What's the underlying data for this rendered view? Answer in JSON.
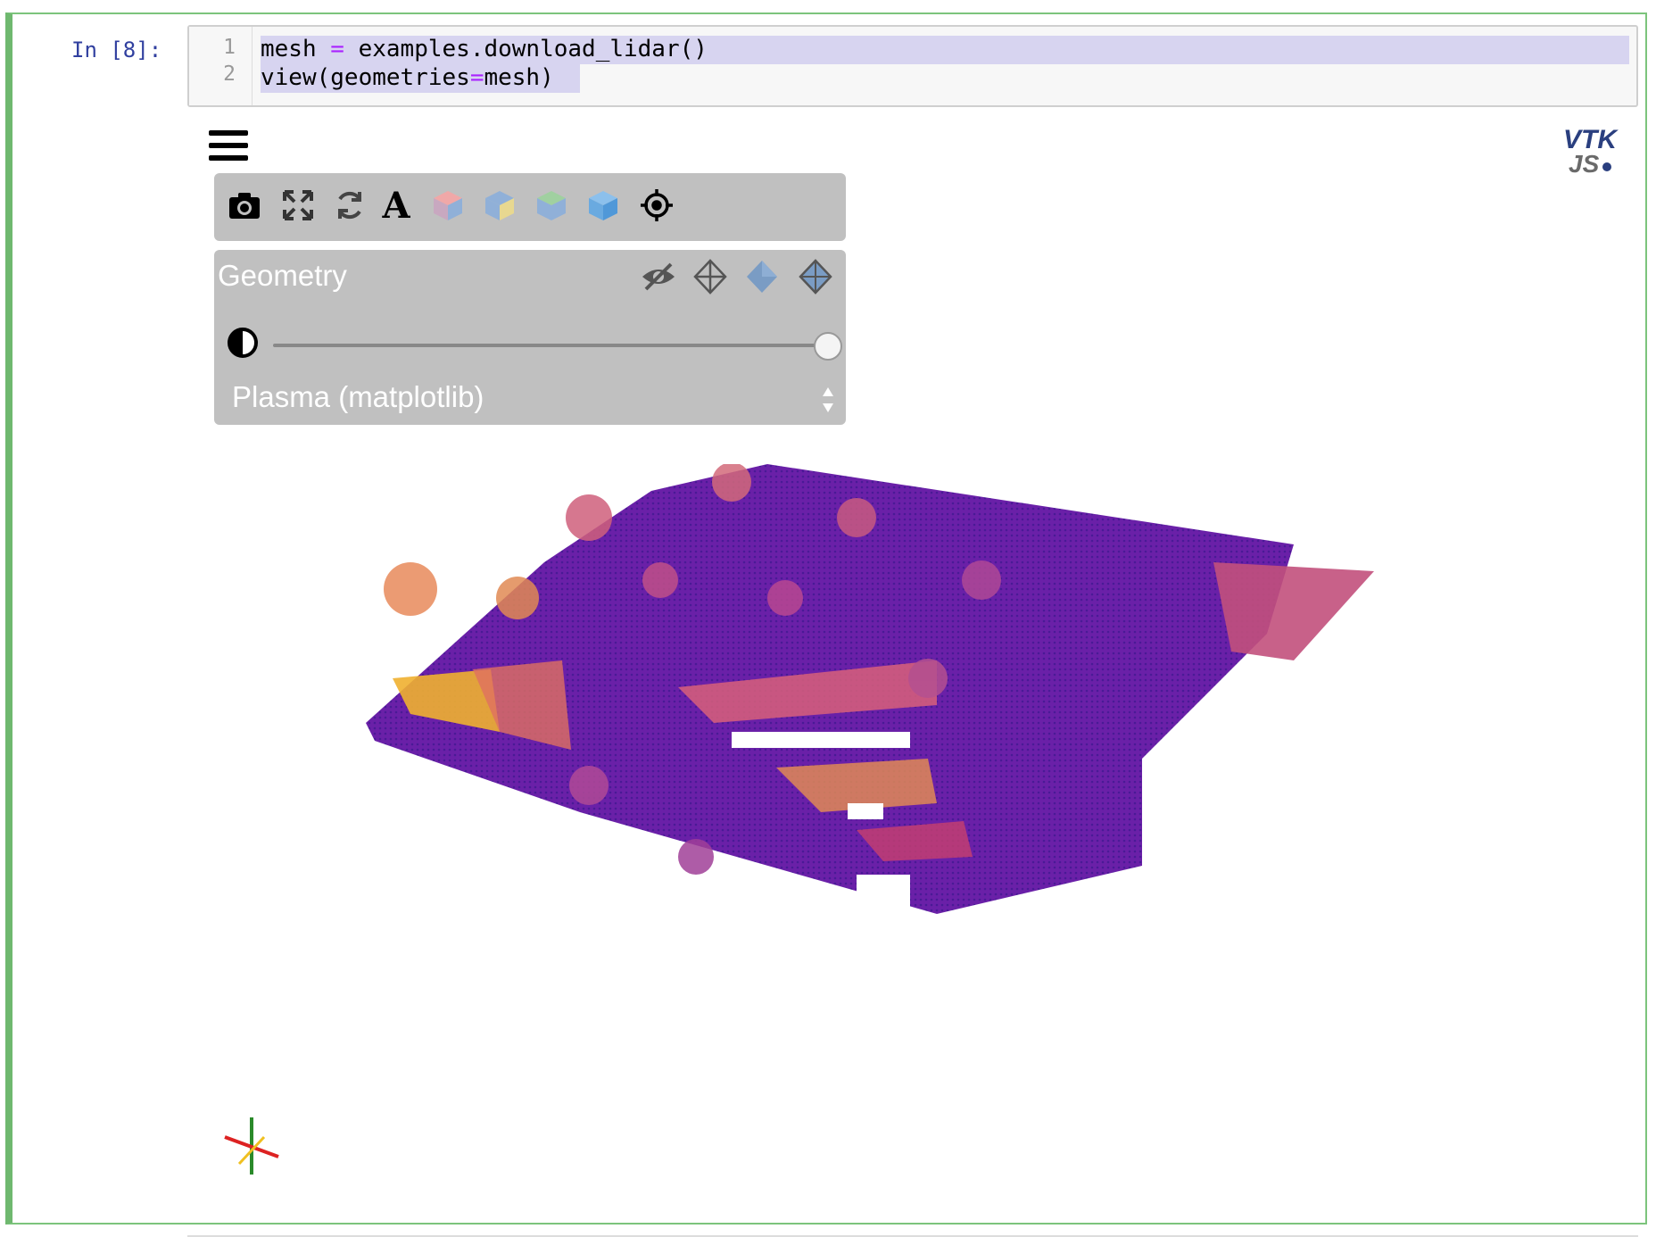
{
  "cell": {
    "prompt": "In [8]:",
    "line_numbers": [
      "1",
      "2"
    ],
    "code": [
      {
        "pre": "mesh ",
        "op": "=",
        "post": " examples.download_lidar()"
      },
      {
        "pre": "view(geometries",
        "op": "=",
        "post": "mesh)"
      }
    ]
  },
  "viewer": {
    "menu_icon": "hamburger-menu-icon",
    "logo_text_top": "VTK",
    "logo_text_bottom": "JS",
    "toolbar": [
      {
        "name": "screenshot-camera-icon",
        "color": "#000000"
      },
      {
        "name": "reset-camera-expand-icon",
        "color": "#333333"
      },
      {
        "name": "rotate-icon",
        "color": "#333333"
      },
      {
        "name": "toggle-orientation-text-icon",
        "color": "#000000"
      },
      {
        "name": "view-x-axis-cube-icon",
        "color": "#e8a0a0"
      },
      {
        "name": "view-y-axis-cube-icon",
        "color": "#e8d890"
      },
      {
        "name": "view-z-axis-cube-icon",
        "color": "#a0d0a0"
      },
      {
        "name": "view-iso-cube-icon",
        "color": "#6aaae0"
      },
      {
        "name": "crosshair-target-icon",
        "color": "#000000"
      }
    ],
    "panel": {
      "title": "Geometry",
      "visibility_icons": [
        "hidden-eye-icon",
        "wireframe-diamond-icon",
        "surface-diamond-icon",
        "surface-with-edges-diamond-icon"
      ],
      "opacity_value": 1.0,
      "colormap": "Plasma (matplotlib)"
    },
    "colormap_colors": [
      "#3b1a8f",
      "#6a1fa8",
      "#9c3a9c",
      "#cc5a7a",
      "#e98a4e",
      "#f5c030"
    ]
  }
}
